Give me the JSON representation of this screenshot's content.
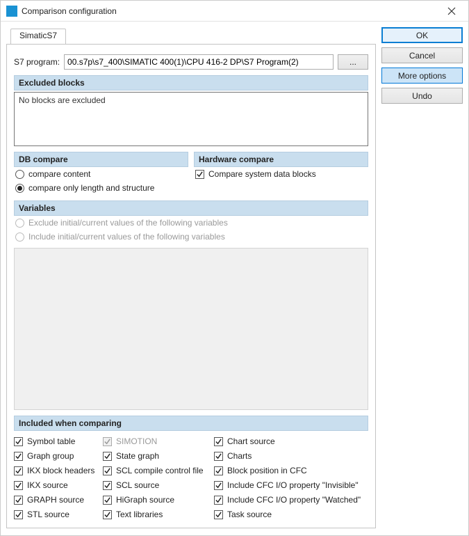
{
  "window": {
    "title": "Comparison configuration"
  },
  "buttons": {
    "ok": "OK",
    "cancel": "Cancel",
    "more": "More options",
    "undo": "Undo",
    "browse": "..."
  },
  "tabs": {
    "simatic": "SimaticS7"
  },
  "s7": {
    "label": "S7 program:",
    "value": "00.s7p\\s7_400\\SIMATIC 400(1)\\CPU 416-2 DP\\S7 Program(2)"
  },
  "sections": {
    "excluded": "Excluded blocks",
    "db": "DB compare",
    "hw": "Hardware compare",
    "vars": "Variables",
    "included": "Included when comparing"
  },
  "excluded_text": "No blocks are excluded",
  "db": {
    "content": "compare content",
    "length": "compare only length and structure"
  },
  "hw": {
    "sysdata": "Compare system data blocks"
  },
  "vars": {
    "exclude": "Exclude initial/current values of the following variables",
    "include": "Include initial/current values of the following variables"
  },
  "included": {
    "c1": {
      "symtable": "Symbol table",
      "graphgroup": "Graph group",
      "ikxhdr": "IKX block headers",
      "ikxsrc": "IKX source",
      "graphsrc": "GRAPH source",
      "stlsrc": "STL source"
    },
    "c2": {
      "simotion": "SIMOTION",
      "stategraph": "State graph",
      "sclcompile": "SCL compile control file",
      "sclsrc": "SCL source",
      "higraph": "HiGraph source",
      "textlib": "Text libraries"
    },
    "c3": {
      "chartsrc": "Chart source",
      "charts": "Charts",
      "blockpos": "Block position in CFC",
      "cfcinv": "Include CFC I/O property \"Invisible\"",
      "cfcwatch": "Include CFC I/O property \"Watched\"",
      "tasksrc": "Task source"
    }
  }
}
